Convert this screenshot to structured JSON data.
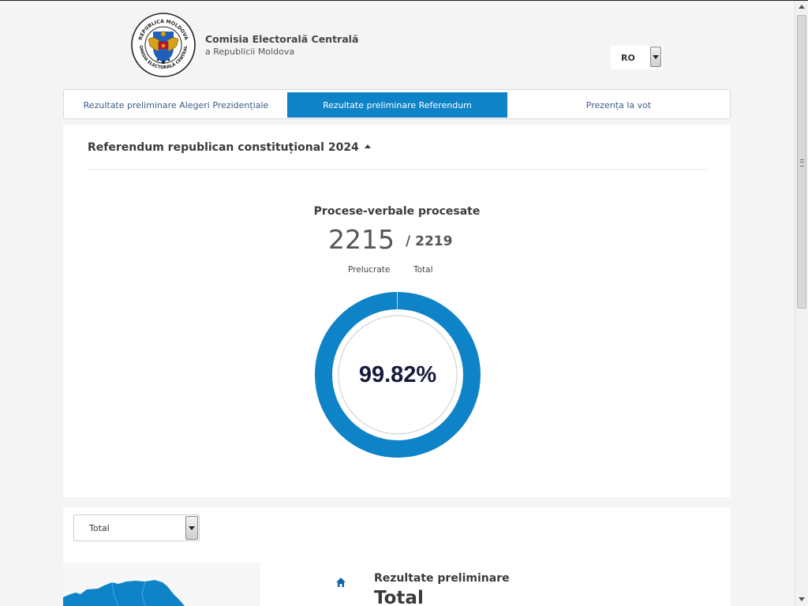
{
  "header": {
    "seal_text_top": "REPUBLICA MOLDOVA",
    "seal_text_bottom": "COMISIA ELECTORALĂ CENTRALĂ",
    "title": "Comisia Electorală Centrală",
    "subtitle": "a Republicii Moldova",
    "language": {
      "selected": "RO"
    }
  },
  "tabs": [
    {
      "label": "Rezultate preliminare Alegeri Prezidențiale",
      "active": false
    },
    {
      "label": "Rezultate preliminare Referendum",
      "active": true
    },
    {
      "label": "Prezența la vot",
      "active": false
    }
  ],
  "referendum": {
    "title": "Referendum republican constituțional 2024",
    "pv_title": "Procese-verbale procesate",
    "processed": "2215",
    "total": "/ 2219",
    "processed_label": "Prelucrate",
    "total_label": "Total",
    "percent_text": "99.82%",
    "percent_value": 0.9982
  },
  "results": {
    "region_select": "Total",
    "title": "Rezultate preliminare",
    "subtitle": "Total"
  },
  "colors": {
    "accent": "#0e83c8",
    "tab_active_text": "#ffffff",
    "page_bg": "#f4f4f4",
    "percent_text": "#151a3a"
  },
  "icons": [
    "seal-logo",
    "chevron-down-icon",
    "caret-up-icon",
    "home-icon",
    "map-thumbnail"
  ]
}
